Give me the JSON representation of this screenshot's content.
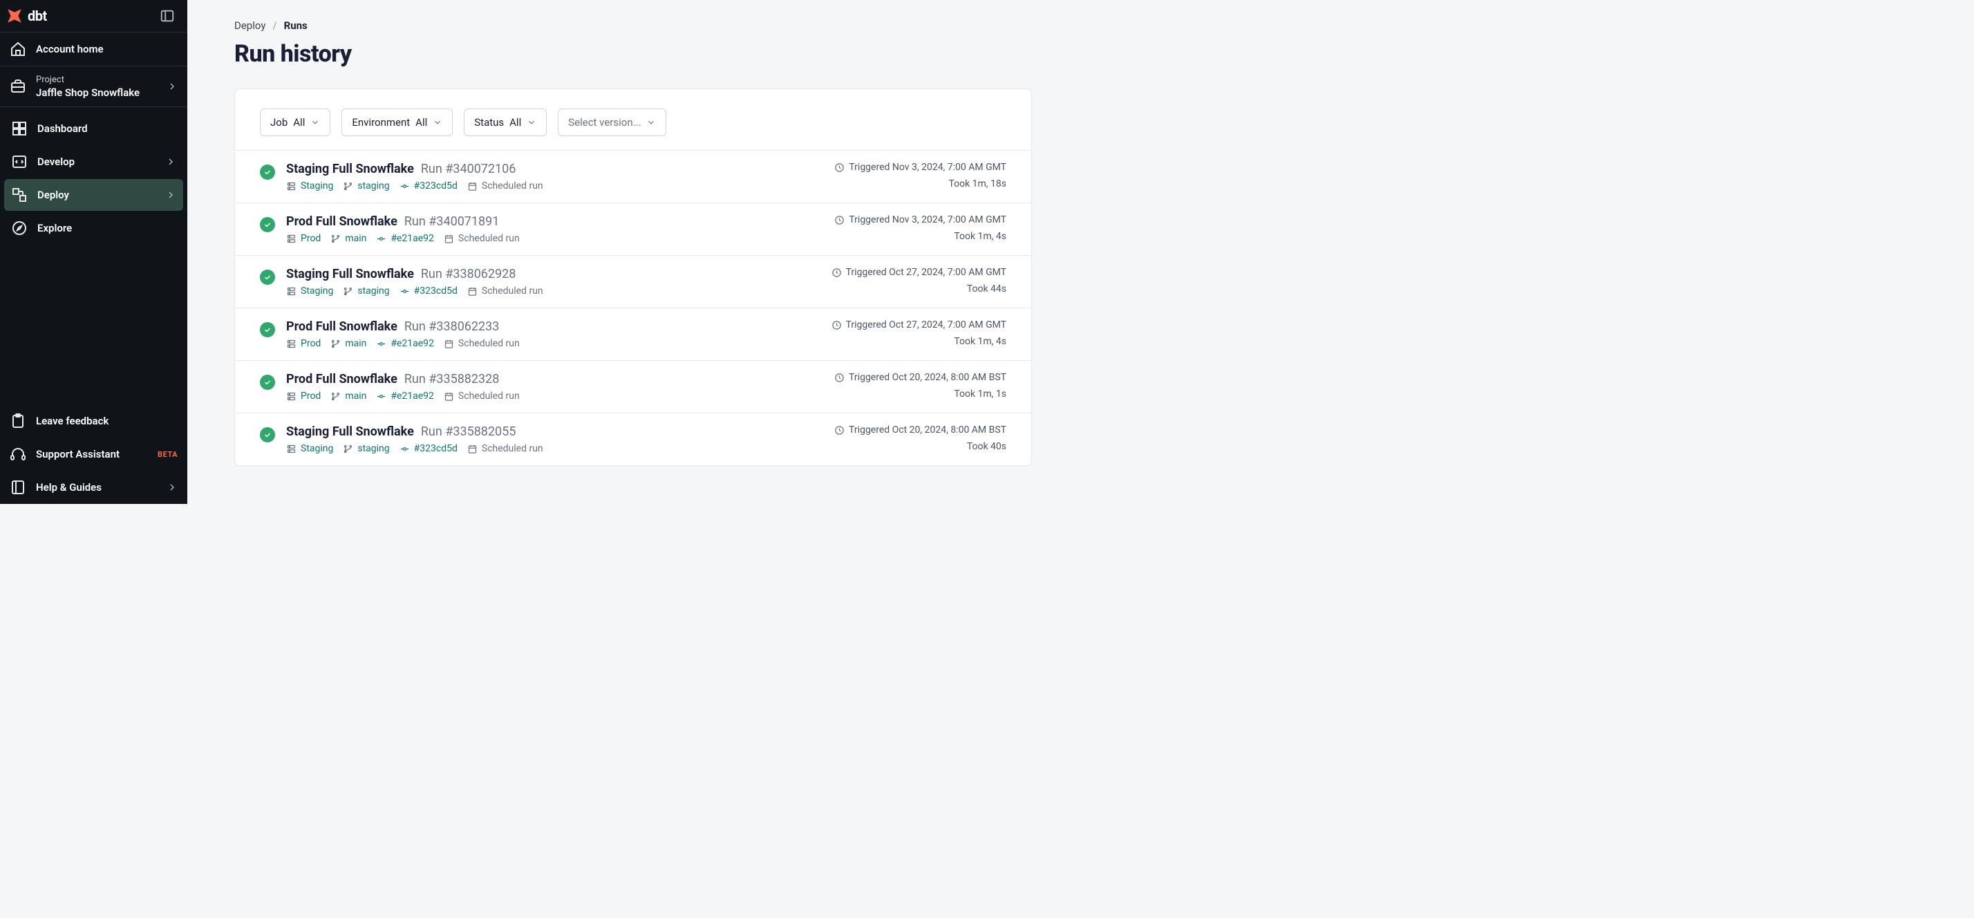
{
  "brand": {
    "name": "dbt"
  },
  "sidebar": {
    "account_home": "Account home",
    "project_label": "Project",
    "project_name": "Jaffle Shop Snowflake",
    "items": {
      "dashboard": "Dashboard",
      "develop": "Develop",
      "deploy": "Deploy",
      "explore": "Explore"
    },
    "bottom": {
      "feedback": "Leave feedback",
      "support": "Support Assistant",
      "support_badge": "BETA",
      "help": "Help & Guides"
    }
  },
  "breadcrumb": {
    "parent": "Deploy",
    "current": "Runs"
  },
  "page": {
    "title": "Run history"
  },
  "filters": {
    "job": {
      "label": "Job",
      "value": "All"
    },
    "environment": {
      "label": "Environment",
      "value": "All"
    },
    "status": {
      "label": "Status",
      "value": "All"
    },
    "version": {
      "placeholder": "Select version..."
    }
  },
  "runs": [
    {
      "job": "Staging Full Snowflake",
      "run": "Run #340072106",
      "env": "Staging",
      "branch": "staging",
      "commit": "#323cd5d",
      "type": "Scheduled run",
      "triggered": "Triggered Nov 3, 2024, 7:00 AM GMT",
      "duration": "Took 1m, 18s"
    },
    {
      "job": "Prod Full Snowflake",
      "run": "Run #340071891",
      "env": "Prod",
      "branch": "main",
      "commit": "#e21ae92",
      "type": "Scheduled run",
      "triggered": "Triggered Nov 3, 2024, 7:00 AM GMT",
      "duration": "Took 1m, 4s"
    },
    {
      "job": "Staging Full Snowflake",
      "run": "Run #338062928",
      "env": "Staging",
      "branch": "staging",
      "commit": "#323cd5d",
      "type": "Scheduled run",
      "triggered": "Triggered Oct 27, 2024, 7:00 AM GMT",
      "duration": "Took 44s"
    },
    {
      "job": "Prod Full Snowflake",
      "run": "Run #338062233",
      "env": "Prod",
      "branch": "main",
      "commit": "#e21ae92",
      "type": "Scheduled run",
      "triggered": "Triggered Oct 27, 2024, 7:00 AM GMT",
      "duration": "Took 1m, 4s"
    },
    {
      "job": "Prod Full Snowflake",
      "run": "Run #335882328",
      "env": "Prod",
      "branch": "main",
      "commit": "#e21ae92",
      "type": "Scheduled run",
      "triggered": "Triggered Oct 20, 2024, 8:00 AM BST",
      "duration": "Took 1m, 1s"
    },
    {
      "job": "Staging Full Snowflake",
      "run": "Run #335882055",
      "env": "Staging",
      "branch": "staging",
      "commit": "#323cd5d",
      "type": "Scheduled run",
      "triggered": "Triggered Oct 20, 2024, 8:00 AM BST",
      "duration": "Took 40s"
    }
  ]
}
